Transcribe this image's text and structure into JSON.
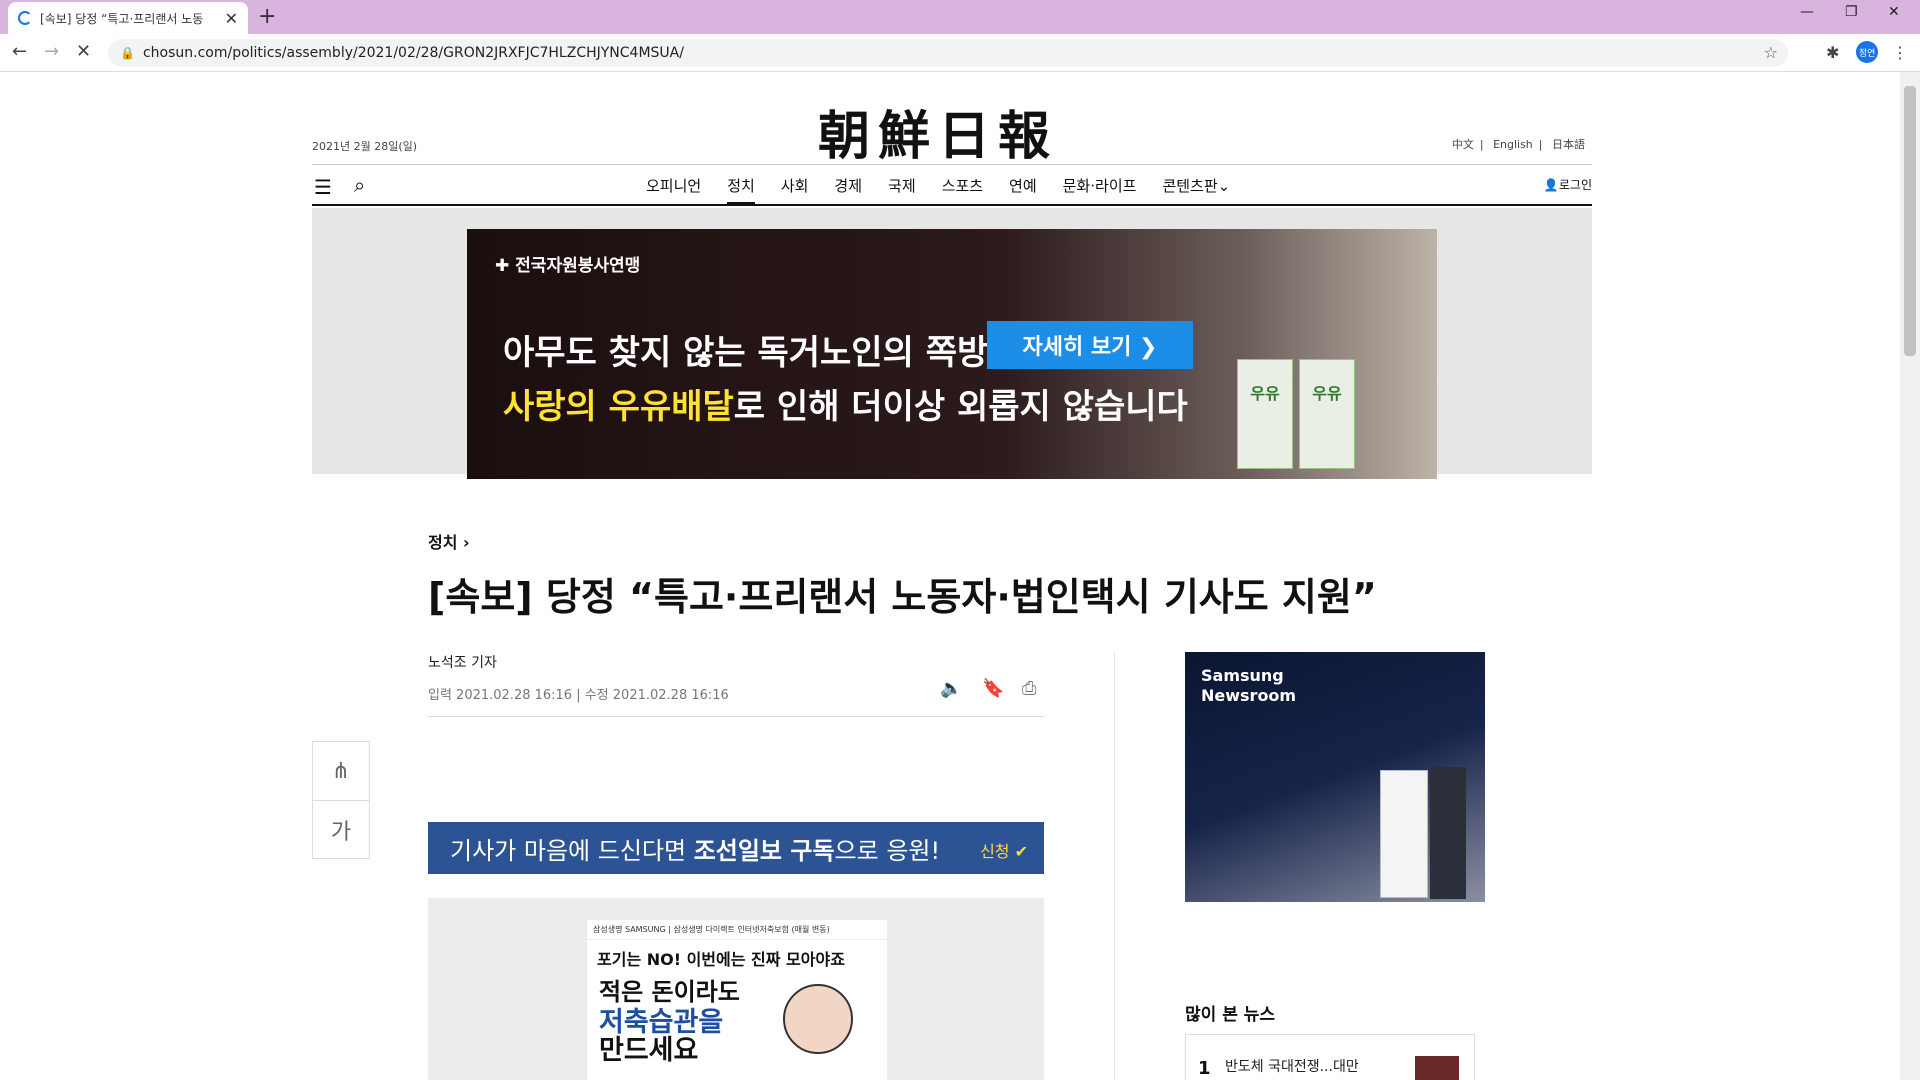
{
  "browser": {
    "tab_title": "[속보] 당정 “특고·프리랜서 노동",
    "url": "chosun.com/politics/assembly/2021/02/28/GRON2JRXFJC7HLZCHJYNC4MSUA/",
    "profile_initials": "정연"
  },
  "masthead": {
    "logo": "朝鮮日報",
    "date": "2021년 2월 28일(일)",
    "languages": [
      "中文",
      "English",
      "日本語"
    ]
  },
  "nav": {
    "items": [
      "오피니언",
      "정치",
      "사회",
      "경제",
      "국제",
      "스포츠",
      "연예",
      "문화·라이프",
      "콘텐츠판"
    ],
    "active_index": 1,
    "login": "로그인"
  },
  "banner": {
    "org": "전국자원봉사연맹",
    "line1": "아무도 찾지 않는 독거노인의 쪽방",
    "line2_highlight": "사랑의 우유배달",
    "line2_rest": "로 인해 더이상 외롭지 않습니다",
    "cta": "자세히 보기 ❯",
    "milk_label": "우유"
  },
  "article": {
    "section": "정치 ›",
    "headline": "[속보] 당정 “특고·프리랜서 노동자·법인택시 기사도 지원”",
    "byline": "노석조 기자",
    "timestamp": "입력 2021.02.28 16:16 | 수정 2021.02.28 16:16"
  },
  "side_tools": {
    "font_label": "가"
  },
  "subscribe": {
    "text_pre": "기사가 마음에 드신다면 ",
    "text_strong": "조선일보 구독",
    "text_post": "으로 응원!",
    "apply": "신청 ✔"
  },
  "inner_ad": {
    "top": "삼성생명  SAMSUNG  |  삼성생명 다이렉트  인터넷저축보험  (매월 변동)",
    "sub": "포기는 NO! 이번에는 진짜 모아야죠",
    "h1": "적은 돈이라도",
    "h2a": "저축습관을",
    "h2b": "만드세요"
  },
  "samsung_ad": {
    "title_line1": "Samsung",
    "title_line2": "Newsroom"
  },
  "popular": {
    "title": "많이 본 뉴스",
    "items": [
      {
        "rank": "1",
        "title": "반도체 국대전쟁...대만 TSMC, 삼성의 '초격차 전략'으로 삼성 넘다"
      }
    ]
  }
}
